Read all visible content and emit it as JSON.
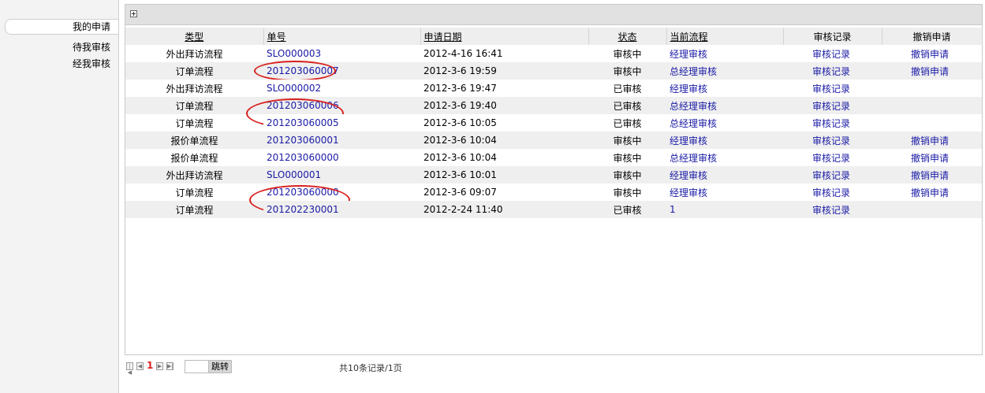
{
  "sidebar": {
    "items": [
      {
        "label": "我的申请"
      },
      {
        "label": "待我审核"
      },
      {
        "label": "经我审核"
      }
    ]
  },
  "table": {
    "headers": {
      "type": "类型",
      "number": "单号",
      "date": "申请日期",
      "status": "状态",
      "flow": "当前流程",
      "audit": "审核记录",
      "revoke": "撤销申请"
    },
    "rows": [
      {
        "type": "外出拜访流程",
        "number": "SLO000003",
        "date": "2012-4-16 16:41",
        "status": "审核中",
        "flow": "经理审核",
        "audit": "审核记录",
        "revoke": "撤销申请"
      },
      {
        "type": "订单流程",
        "number": "201203060007",
        "date": "2012-3-6 19:59",
        "status": "审核中",
        "flow": "总经理审核",
        "audit": "审核记录",
        "revoke": "撤销申请"
      },
      {
        "type": "外出拜访流程",
        "number": "SLO000002",
        "date": "2012-3-6 19:47",
        "status": "已审核",
        "flow": "经理审核",
        "audit": "审核记录",
        "revoke": ""
      },
      {
        "type": "订单流程",
        "number": "201203060006",
        "date": "2012-3-6 19:40",
        "status": "已审核",
        "flow": "总经理审核",
        "audit": "审核记录",
        "revoke": ""
      },
      {
        "type": "订单流程",
        "number": "201203060005",
        "date": "2012-3-6 10:05",
        "status": "已审核",
        "flow": "总经理审核",
        "audit": "审核记录",
        "revoke": ""
      },
      {
        "type": "报价单流程",
        "number": "201203060001",
        "date": "2012-3-6 10:04",
        "status": "审核中",
        "flow": "经理审核",
        "audit": "审核记录",
        "revoke": "撤销申请"
      },
      {
        "type": "报价单流程",
        "number": "201203060000",
        "date": "2012-3-6 10:04",
        "status": "审核中",
        "flow": "总经理审核",
        "audit": "审核记录",
        "revoke": "撤销申请"
      },
      {
        "type": "外出拜访流程",
        "number": "SLO000001",
        "date": "2012-3-6 10:01",
        "status": "审核中",
        "flow": "经理审核",
        "audit": "审核记录",
        "revoke": "撤销申请"
      },
      {
        "type": "订单流程",
        "number": "201203060000",
        "date": "2012-3-6 09:07",
        "status": "审核中",
        "flow": "经理审核",
        "audit": "审核记录",
        "revoke": "撤销申请"
      },
      {
        "type": "订单流程",
        "number": "201202230001",
        "date": "2012-2-24 11:40",
        "status": "已审核",
        "flow": "1",
        "audit": "审核记录",
        "revoke": ""
      }
    ]
  },
  "pager": {
    "current_page": "1",
    "jump_label": "跳转",
    "summary": "共10条记录/1页"
  },
  "colors": {
    "link": "#1a1aa6",
    "annotation": "#d8201e",
    "header_bg": "#eeeeee",
    "stripe_bg": "#efefef"
  }
}
